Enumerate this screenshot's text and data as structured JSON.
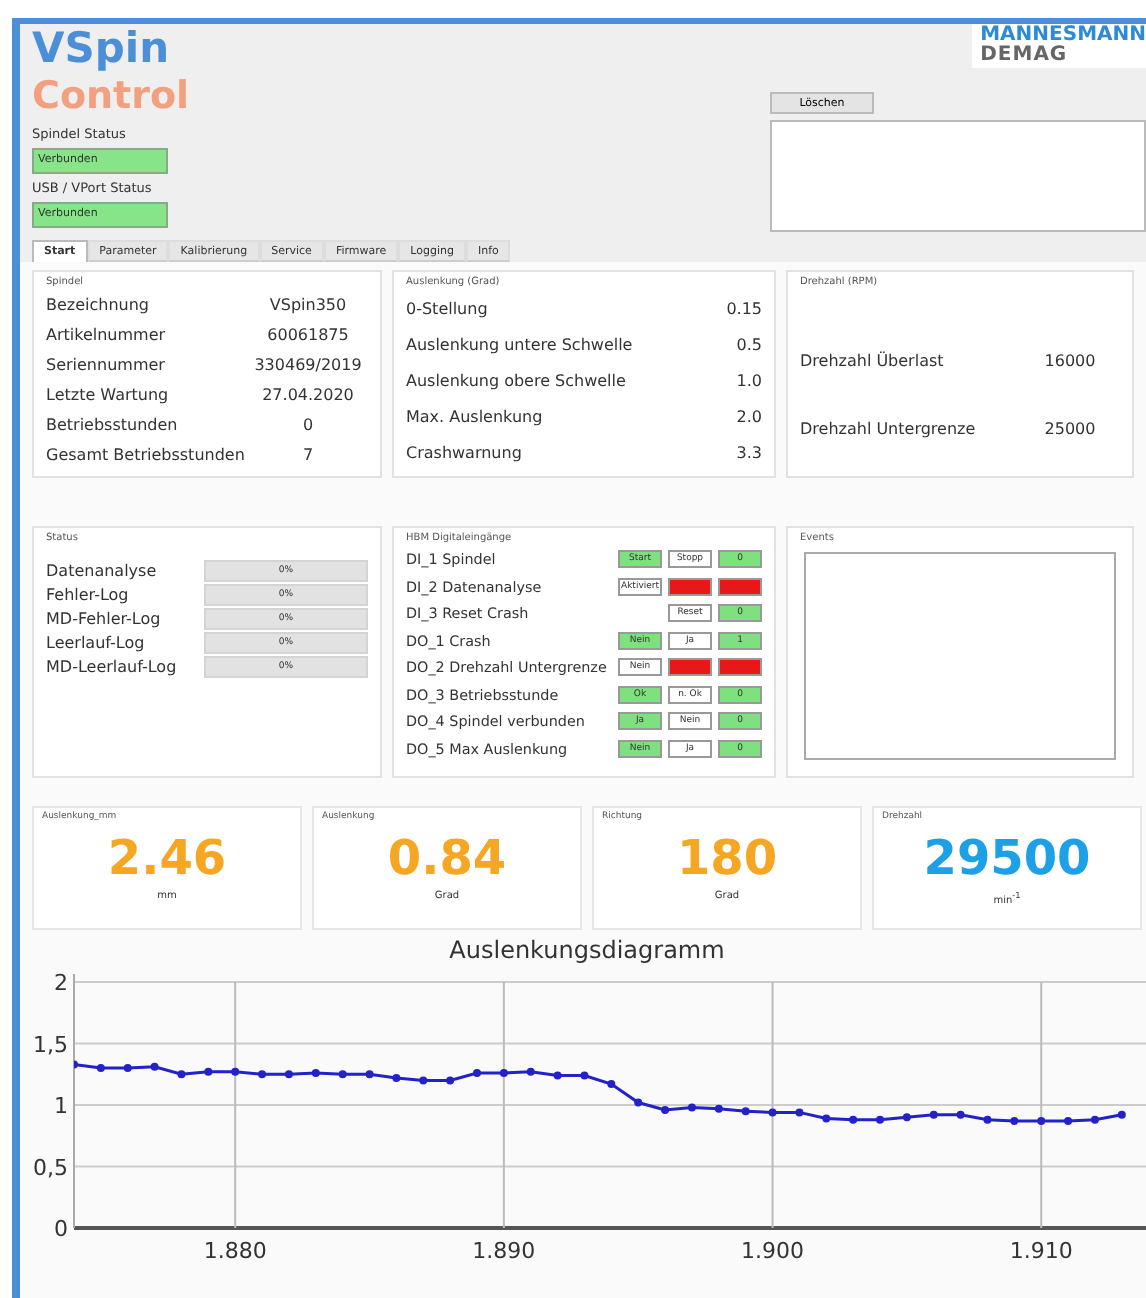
{
  "header": {
    "title": "VSpin",
    "subtitle": "Control",
    "logo_top": "MANNESMANN",
    "logo_bottom": "DEMAG"
  },
  "status_fields": [
    {
      "label": "Spindel Status",
      "value": "Verbunden"
    },
    {
      "label": "USB / VPort Status",
      "value": "Verbunden"
    }
  ],
  "log": {
    "clear_button": "Löschen"
  },
  "tabs": [
    {
      "label": "Start",
      "selected": true
    },
    {
      "label": "Parameter",
      "selected": false
    },
    {
      "label": "Kalibrierung",
      "selected": false
    },
    {
      "label": "Service",
      "selected": false
    },
    {
      "label": "Firmware",
      "selected": false
    },
    {
      "label": "Logging",
      "selected": false
    },
    {
      "label": "Info",
      "selected": false
    }
  ],
  "spindel": {
    "title": "Spindel",
    "rows": [
      {
        "label": "Bezeichnung",
        "value": "VSpin350"
      },
      {
        "label": "Artikelnummer",
        "value": "60061875"
      },
      {
        "label": "Seriennummer",
        "value": "330469/2019"
      },
      {
        "label": "Letzte Wartung",
        "value": "27.04.2020"
      },
      {
        "label": "Betriebsstunden",
        "value": "0"
      },
      {
        "label": "Gesamt Betriebsstunden",
        "value": "7"
      }
    ]
  },
  "auslenkung": {
    "title": "Auslenkung (Grad)",
    "rows": [
      {
        "label": "0-Stellung",
        "value": "0.15"
      },
      {
        "label": "Auslenkung untere Schwelle",
        "value": "0.5"
      },
      {
        "label": "Auslenkung obere Schwelle",
        "value": "1.0"
      },
      {
        "label": "Max. Auslenkung",
        "value": "2.0"
      },
      {
        "label": "Crashwarnung",
        "value": "3.3"
      }
    ]
  },
  "drehzahl": {
    "title": "Drehzahl (RPM)",
    "rows": [
      {
        "label": "Drehzahl Überlast",
        "value": "16000"
      },
      {
        "label": "Drehzahl Untergrenze",
        "value": "25000"
      }
    ]
  },
  "status": {
    "title": "Status",
    "rows": [
      {
        "label": "Datenanalyse",
        "reading": "0%",
        "level": 0
      },
      {
        "label": "Fehler-Log",
        "reading": "0%",
        "level": 0
      },
      {
        "label": "MD-Fehler-Log",
        "reading": "0%",
        "level": 0
      },
      {
        "label": "Leerlauf-Log",
        "reading": "0%",
        "level": 0
      },
      {
        "label": "MD-Leerlauf-Log",
        "reading": "0%",
        "level": 0
      }
    ]
  },
  "hbm": {
    "title": "HBM Digitaleingänge",
    "rows": [
      {
        "label": "DI_1 Spindel",
        "first": {
          "text": "Start",
          "color": "#7ee07e"
        },
        "second": {
          "text": "Stopp",
          "color": "#ffffff"
        },
        "state": {
          "text": "0",
          "color": "#7ee07e"
        }
      },
      {
        "label": "DI_2 Datenanalyse",
        "first": {
          "text": "Aktiviert",
          "color": "#ffffff"
        },
        "second": {
          "color": "#e81818"
        },
        "state": {
          "color": "#e81818"
        }
      },
      {
        "label": "DI_3 Reset Crash",
        "second": {
          "text": "Reset",
          "color": "#ffffff"
        },
        "state": {
          "text": "0",
          "color": "#7ee07e"
        }
      },
      {
        "label": "DO_1 Crash",
        "first": {
          "text": "Nein",
          "color": "#7ee07e"
        },
        "second": {
          "text": "Ja",
          "color": "#ffffff"
        },
        "state": {
          "text": "1",
          "color": "#7ee07e"
        }
      },
      {
        "label": "DO_2 Drehzahl Untergrenze",
        "first": {
          "text": "Nein",
          "color": "#ffffff"
        },
        "second": {
          "color": "#e81818"
        },
        "state": {
          "color": "#e81818"
        }
      },
      {
        "label": "DO_3 Betriebsstunde",
        "first": {
          "text": "Ok",
          "color": "#7ee07e"
        },
        "second": {
          "text": "n. Ok",
          "color": "#ffffff"
        },
        "state": {
          "text": "0",
          "color": "#7ee07e"
        }
      },
      {
        "label": "DO_4 Spindel verbunden",
        "first": {
          "text": "Ja",
          "color": "#7ee07e"
        },
        "second": {
          "text": "Nein",
          "color": "#ffffff"
        },
        "state": {
          "text": "0",
          "color": "#7ee07e"
        }
      },
      {
        "label": "DO_5 Max Auslenkung",
        "first": {
          "text": "Nein",
          "color": "#7ee07e"
        },
        "second": {
          "text": "Ja",
          "color": "#ffffff"
        },
        "state": {
          "text": "0",
          "color": "#7ee07e"
        }
      }
    ]
  },
  "events": {
    "title": "Events"
  },
  "readouts": [
    {
      "title": "Auslenkung_mm",
      "value": "2.46",
      "unit": "mm",
      "color": "#f5a623"
    },
    {
      "title": "Auslenkung",
      "value": "0.84",
      "unit": "Grad",
      "color": "#f5a623"
    },
    {
      "title": "Richtung",
      "value": "180",
      "unit": "Grad",
      "color": "#f5a623"
    },
    {
      "title": "Drehzahl",
      "value": "29500",
      "unit": "min$^{-1}$",
      "color": "#1ea0e6"
    }
  ],
  "chart": {
    "chart_data": {
      "type": "line",
      "title": "Auslenkungsdiagramm",
      "x": [
        1.874,
        1.875,
        1.876,
        1.877,
        1.878,
        1.879,
        1.88,
        1.881,
        1.882,
        1.883,
        1.884,
        1.885,
        1.886,
        1.887,
        1.888,
        1.889,
        1.89,
        1.891,
        1.892,
        1.893,
        1.894,
        1.895,
        1.896,
        1.897,
        1.898,
        1.899,
        1.9,
        1.901,
        1.902,
        1.903,
        1.904,
        1.905,
        1.906,
        1.907,
        1.908,
        1.909,
        1.91,
        1.911,
        1.912,
        1.913
      ],
      "grid": true,
      "series": [
        {
          "color": "#2222c8",
          "marker": true,
          "values": [
            1.33,
            1.3,
            1.3,
            1.31,
            1.25,
            1.27,
            1.27,
            1.25,
            1.25,
            1.26,
            1.25,
            1.25,
            1.22,
            1.2,
            1.2,
            1.26,
            1.26,
            1.27,
            1.24,
            1.24,
            1.17,
            1.02,
            0.96,
            0.98,
            0.97,
            0.95,
            0.94,
            0.94,
            0.89,
            0.88,
            0.88,
            0.9,
            0.92,
            0.92,
            0.88,
            0.87,
            0.87,
            0.87,
            0.88,
            0.92
          ]
        }
      ],
      "xlim": [
        1.874,
        1.9139
      ],
      "ylim": [
        0,
        2
      ],
      "xticks": [
        {
          "value": 1.88,
          "label": "1.880"
        },
        {
          "value": 1.89,
          "label": "1.890"
        },
        {
          "value": 1.9,
          "label": "1.900"
        },
        {
          "value": 1.91,
          "label": "1.910"
        }
      ],
      "yticks": [
        {
          "value": 0,
          "label": "0"
        },
        {
          "value": 0.5,
          "label": "0,5"
        },
        {
          "value": 1,
          "label": "1"
        },
        {
          "value": 1.5,
          "label": "1,5"
        },
        {
          "value": 2,
          "label": "2"
        }
      ]
    }
  }
}
